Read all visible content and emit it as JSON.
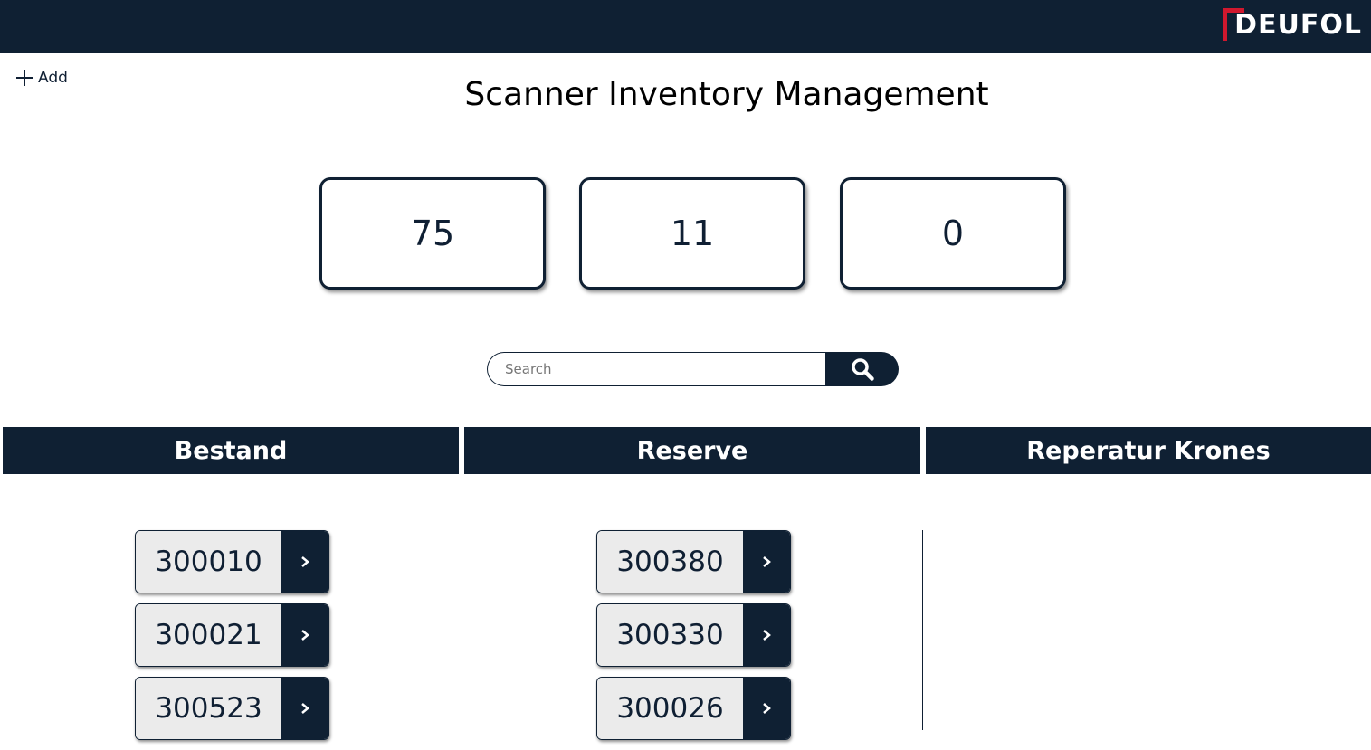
{
  "brand": {
    "logo_text": "DEUFOL",
    "logo_color": "#d0182e",
    "header_color": "#0f2033"
  },
  "toolbar": {
    "add_label": "Add",
    "add_icon": "plus-icon"
  },
  "page": {
    "title": "Scanner Inventory Management"
  },
  "stats": [
    "75",
    "11",
    "0"
  ],
  "search": {
    "placeholder": "Search",
    "value": "",
    "icon": "search-icon"
  },
  "columns": [
    {
      "title": "Bestand",
      "items": [
        "300010",
        "300021",
        "300523"
      ]
    },
    {
      "title": "Reserve",
      "items": [
        "300380",
        "300330",
        "300026"
      ]
    },
    {
      "title": "Reperatur Krones",
      "items": []
    }
  ],
  "item_action_icon": "chevron-right-icon"
}
